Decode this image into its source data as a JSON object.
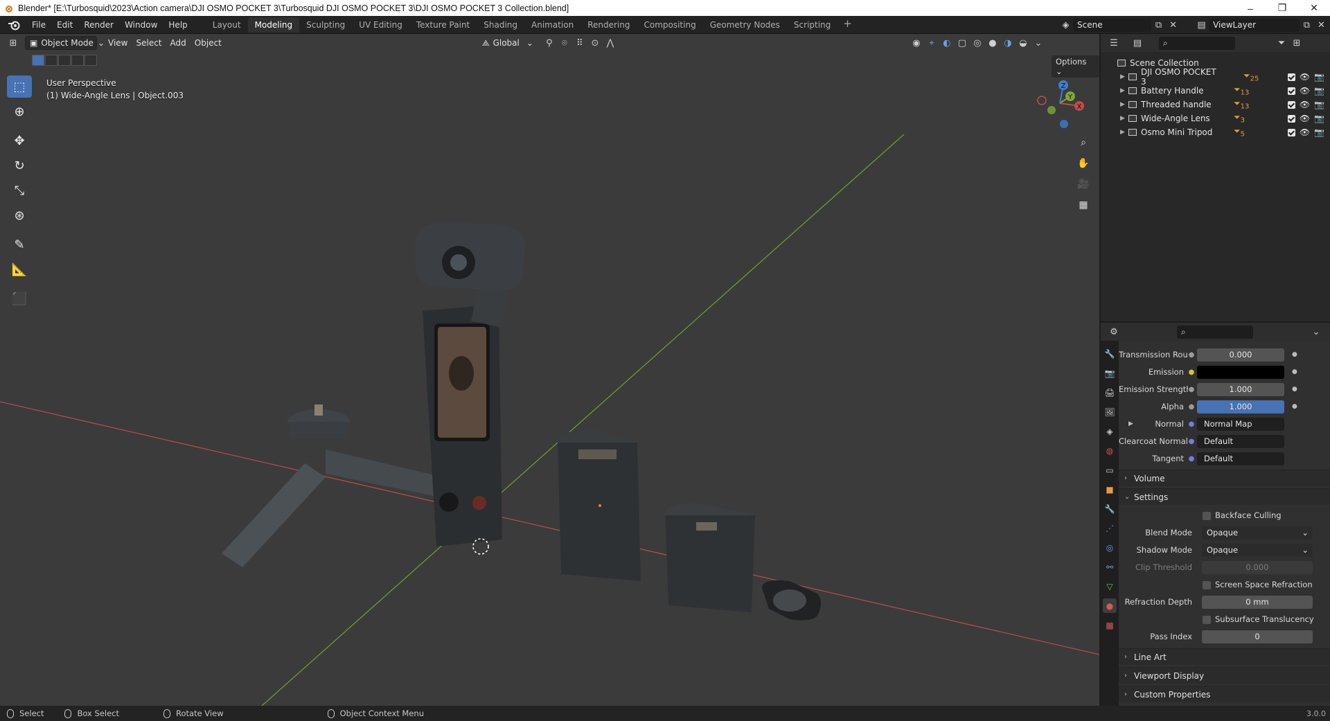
{
  "window": {
    "title": "Blender* [E:\\Turbosquid\\2023\\Action camera\\DJI OSMO POCKET 3\\Turbosquid DJI OSMO POCKET 3\\DJI OSMO POCKET 3 Collection.blend]",
    "minimize": "–",
    "maximize": "❐",
    "close": "✕"
  },
  "menubar": {
    "items": [
      "File",
      "Edit",
      "Render",
      "Window",
      "Help"
    ]
  },
  "workspaces": {
    "tabs": [
      "Layout",
      "Modeling",
      "Sculpting",
      "UV Editing",
      "Texture Paint",
      "Shading",
      "Animation",
      "Rendering",
      "Compositing",
      "Geometry Nodes",
      "Scripting"
    ],
    "active": "Modeling",
    "add": "+"
  },
  "scene": {
    "name": "Scene"
  },
  "viewlayer": {
    "name": "ViewLayer"
  },
  "viewport": {
    "mode": "Object Mode",
    "menus": [
      "View",
      "Select",
      "Add",
      "Object"
    ],
    "transform_orientation": "Global",
    "perspective": "User Perspective",
    "active_object": "(1) Wide-Angle Lens | Object.003",
    "options": "Options",
    "gizmo": {
      "x": "X",
      "y": "Y",
      "z": "Z"
    }
  },
  "outliner": {
    "root": "Scene Collection",
    "collections": [
      {
        "name": "DJI OSMO POCKET 3",
        "count": "25"
      },
      {
        "name": "Battery Handle",
        "count": "13"
      },
      {
        "name": "Threaded handle",
        "count": "13"
      },
      {
        "name": "Wide-Angle Lens",
        "count": "3"
      },
      {
        "name": "Osmo Mini Tripod",
        "count": "5"
      }
    ]
  },
  "properties": {
    "rows": {
      "transmission_roughness": {
        "label": "Transmission Rou...",
        "value": "0.000"
      },
      "emission": {
        "label": "Emission"
      },
      "emission_strength": {
        "label": "Emission Strength",
        "value": "1.000"
      },
      "alpha": {
        "label": "Alpha",
        "value": "1.000"
      },
      "normal": {
        "label": "Normal",
        "value": "Normal Map"
      },
      "clearcoat_normal": {
        "label": "Clearcoat Normal",
        "value": "Default"
      },
      "tangent": {
        "label": "Tangent",
        "value": "Default"
      }
    },
    "panels": {
      "volume": "Volume",
      "settings": "Settings",
      "line_art": "Line Art",
      "viewport_display": "Viewport Display",
      "custom_properties": "Custom Properties"
    },
    "settings": {
      "backface_culling": "Backface Culling",
      "blend_mode_label": "Blend Mode",
      "blend_mode": "Opaque",
      "shadow_mode_label": "Shadow Mode",
      "shadow_mode": "Opaque",
      "clip_threshold_label": "Clip Threshold",
      "clip_threshold": "0.000",
      "screen_space_refraction": "Screen Space Refraction",
      "refraction_depth_label": "Refraction Depth",
      "refraction_depth": "0 mm",
      "subsurface_translucency": "Subsurface Translucency",
      "pass_index_label": "Pass Index",
      "pass_index": "0"
    }
  },
  "statusbar": {
    "select": "Select",
    "box_select": "Box Select",
    "rotate_view": "Rotate View",
    "context_menu": "Object Context Menu",
    "version": "3.0.0"
  },
  "colors": {
    "accent": "#4772b3",
    "viewport_bg": "#3b3b3b",
    "x_axis": "#c24b4b",
    "y_axis": "#7ea935",
    "z_axis": "#3f7ed0"
  }
}
